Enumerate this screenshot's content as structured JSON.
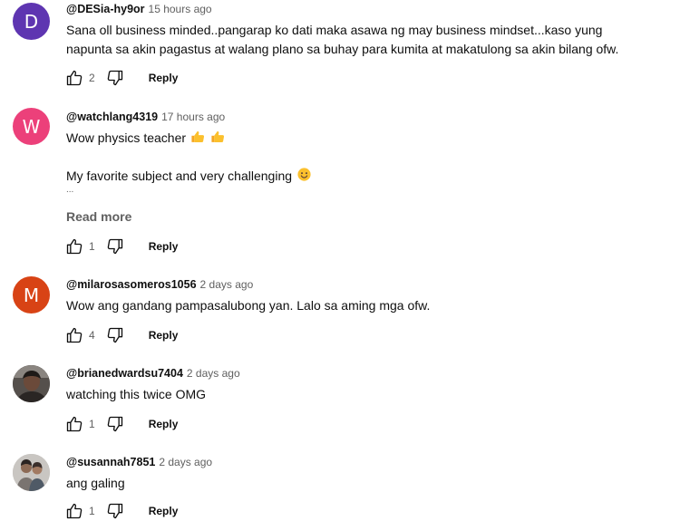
{
  "comments": [
    {
      "author": "@DESia-hy9or",
      "time": "15 hours ago",
      "avatar": {
        "letter": "D",
        "color": "#5e35b1"
      },
      "lines": [
        "Sana oll business minded..pangarap ko dati maka asawa ng may business mindset...kaso yung",
        "napunta sa akin pagastus at walang plano sa buhay para kumita at makatulong sa akin bilang ofw."
      ],
      "likes": "2",
      "reply_label": "Reply"
    },
    {
      "author": "@watchlang4319",
      "time": "17 hours ago",
      "avatar": {
        "letter": "W",
        "color": "#ec407a"
      },
      "line1": "Wow physics teacher",
      "line2": "My favorite subject and very challenging",
      "ellipsis": "...",
      "read_more": "Read more",
      "likes": "1",
      "reply_label": "Reply"
    },
    {
      "author": "@milarosasomeros1056",
      "time": "2 days ago",
      "avatar": {
        "letter": "M",
        "color": "#d84315"
      },
      "text": "Wow ang gandang pampasalubong yan. Lalo sa aming mga ofw.",
      "likes": "4",
      "reply_label": "Reply"
    },
    {
      "author": "@brianedwardsu7404",
      "time": "2 days ago",
      "avatar": {
        "photo": "dark-portrait"
      },
      "text": "watching this twice OMG",
      "likes": "1",
      "reply_label": "Reply"
    },
    {
      "author": "@susannah7851",
      "time": "2 days ago",
      "avatar": {
        "photo": "couple-portrait"
      },
      "text": "ang galing",
      "likes": "1",
      "reply_label": "Reply"
    }
  ],
  "icons": {
    "like": "thumbs-up-icon",
    "dislike": "thumbs-down-icon",
    "emoji_thumbs": "thumbs-up-emoji",
    "emoji_smile": "smiling-face-emoji"
  },
  "colors": {
    "text": "#0f0f0f",
    "secondary": "#606060"
  }
}
